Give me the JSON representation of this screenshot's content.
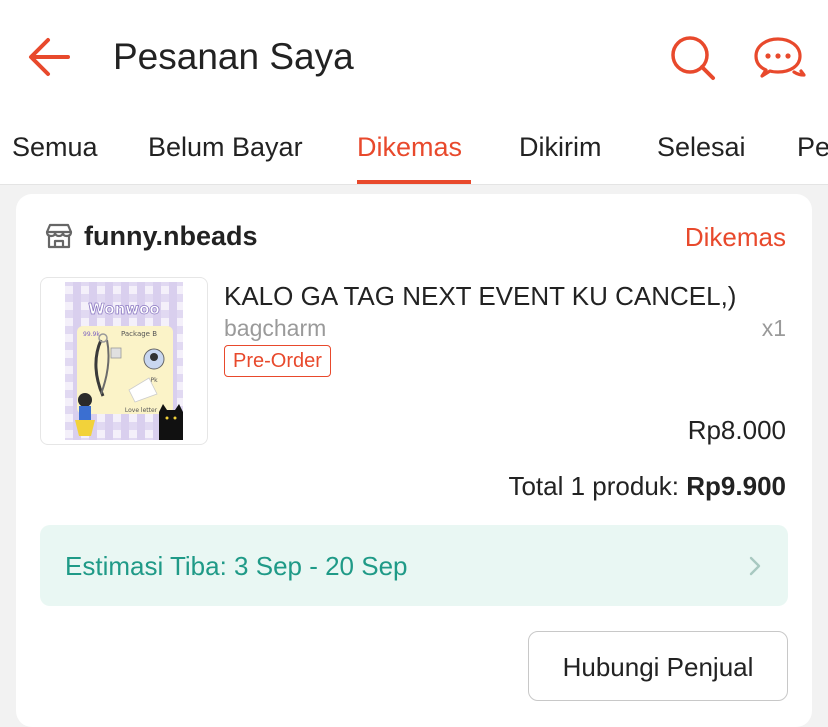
{
  "header": {
    "title": "Pesanan Saya",
    "back_icon": "arrow-left-icon",
    "search_icon": "search-icon",
    "chat_icon": "chat-icon",
    "accent_color": "#e8492c"
  },
  "tabs": [
    {
      "label": "Semua",
      "active": false
    },
    {
      "label": "Belum Bayar",
      "active": false
    },
    {
      "label": "Dikemas",
      "active": true
    },
    {
      "label": "Dikirim",
      "active": false
    },
    {
      "label": "Selesai",
      "active": false
    },
    {
      "label": "Pe",
      "active": false
    }
  ],
  "order": {
    "shop_icon": "store-icon",
    "shop_name": "funny.nbeads",
    "status": "Dikemas",
    "product": {
      "name": "KALO GA TAG NEXT EVENT KU CANCEL,)",
      "variant": "bagcharm",
      "quantity": "x1",
      "badge": "Pre-Order",
      "price": "Rp8.000"
    },
    "total_label": "Total 1 produk:",
    "total_value": "Rp9.900",
    "estimate": {
      "text": "Estimasi Tiba: 3 Sep - 20 Sep",
      "color": "#1f9a87",
      "chevron_icon": "chevron-right-icon"
    },
    "contact_button": "Hubungi Penjual"
  },
  "thumbnail": {
    "title": "Wonwoo",
    "subtitle": "Package B",
    "price_tag": "99.9k",
    "label_pk": "Pk",
    "label_letter": "Love letter"
  }
}
